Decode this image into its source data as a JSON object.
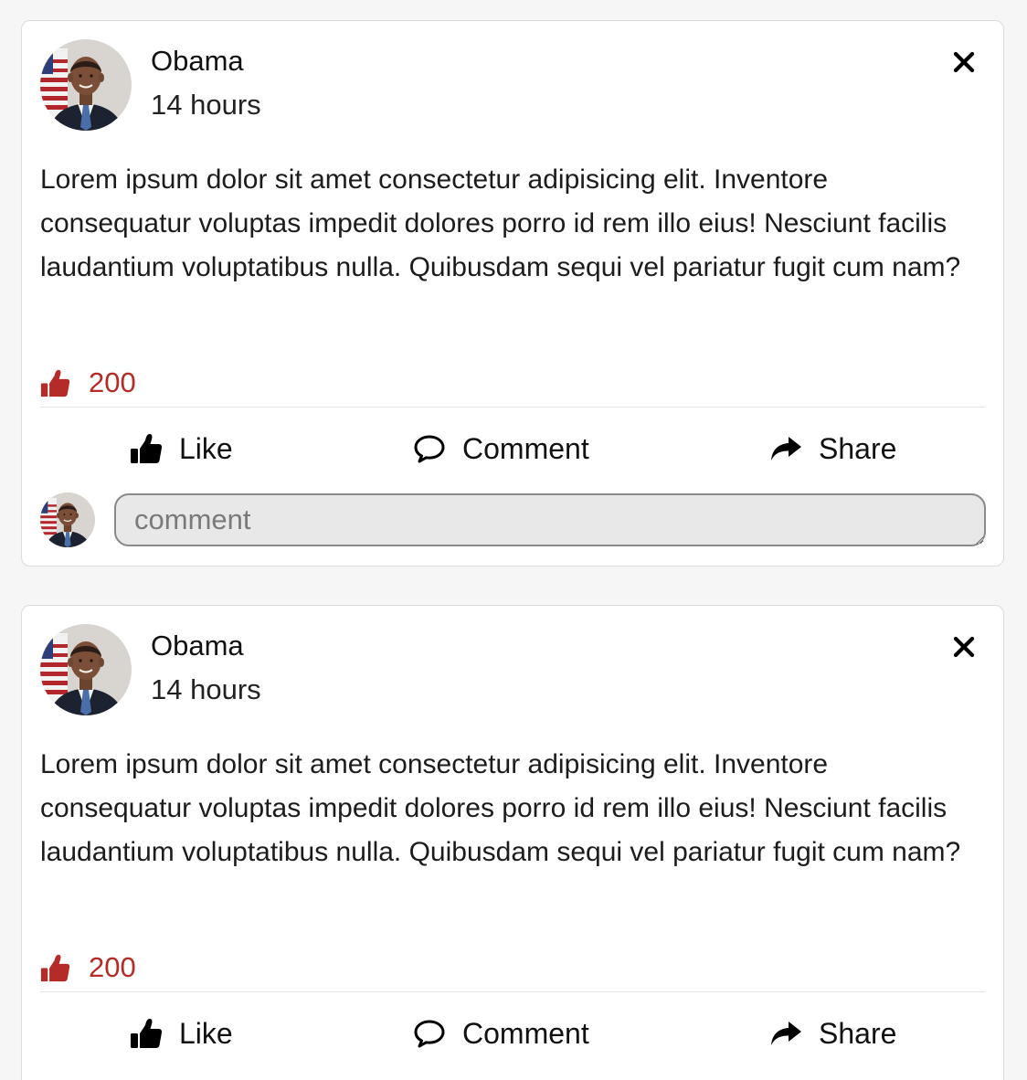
{
  "posts": [
    {
      "author": "Obama",
      "time": "14 hours",
      "text": "Lorem ipsum dolor sit amet consectetur adipisicing elit. Inventore consequatur voluptas impedit dolores porro id rem illo eius! Nesciunt facilis laudantium voluptatibus nulla. Quibusdam sequi vel pariatur fugit cum nam?",
      "likes": "200",
      "actions": {
        "like": "Like",
        "comment": "Comment",
        "share": "Share"
      },
      "comment_placeholder": "comment"
    },
    {
      "author": "Obama",
      "time": "14 hours",
      "text": "Lorem ipsum dolor sit amet consectetur adipisicing elit. Inventore consequatur voluptas impedit dolores porro id rem illo eius! Nesciunt facilis laudantium voluptatibus nulla. Quibusdam sequi vel pariatur fugit cum nam?",
      "likes": "200",
      "actions": {
        "like": "Like",
        "comment": "Comment",
        "share": "Share"
      }
    }
  ],
  "icons": {
    "close": "close-icon",
    "likes_badge": "thumbs-up-icon",
    "like": "thumbs-up-icon",
    "comment": "speech-bubble-icon",
    "share": "share-arrow-icon"
  },
  "colors": {
    "likes_accent": "#b52b27",
    "card_border": "#dcdcdc",
    "page_background": "#f6f6f6"
  }
}
